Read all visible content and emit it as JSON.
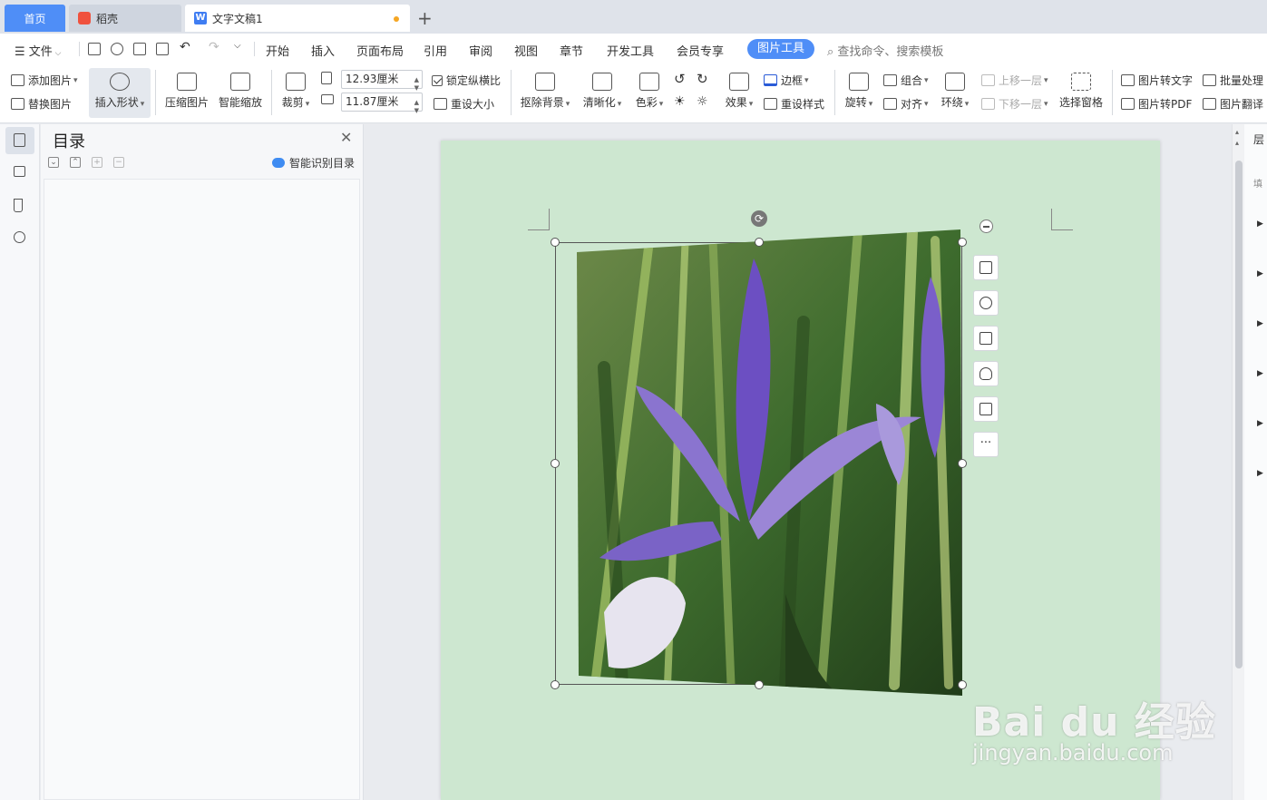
{
  "tabs": {
    "home": "首页",
    "daoke": "稻壳",
    "doc": "文字文稿1"
  },
  "menu": {
    "file": "文件",
    "items": [
      "开始",
      "插入",
      "页面布局",
      "引用",
      "审阅",
      "视图",
      "章节",
      "开发工具",
      "会员专享"
    ],
    "active": "图片工具",
    "search_placeholder": "查找命令、搜索模板"
  },
  "ribbon": {
    "add_image": "添加图片",
    "replace_image": "替换图片",
    "insert_shape": "插入形状",
    "compress": "压缩图片",
    "smart_zoom": "智能缩放",
    "crop": "裁剪",
    "width_value": "12.93厘米",
    "height_value": "11.87厘米",
    "lock_ratio": "锁定纵横比",
    "reset_size": "重设大小",
    "remove_bg": "抠除背景",
    "sharpen": "清晰化",
    "color": "色彩",
    "effects": "效果",
    "border": "边框",
    "reset_style": "重设样式",
    "rotate": "旋转",
    "group": "组合",
    "align": "对齐",
    "wrap": "环绕",
    "bring_forward": "上移一层",
    "send_backward": "下移一层",
    "selection_pane": "选择窗格",
    "img_to_text": "图片转文字",
    "img_to_pdf": "图片转PDF",
    "batch": "批量处理",
    "translate": "图片翻译"
  },
  "toc": {
    "title": "目录",
    "smart_recognize": "智能识别目录"
  },
  "float_tools": {
    "more": "···"
  },
  "watermark": {
    "brand": "Bai du 经验",
    "url": "jingyan.baidu.com"
  },
  "right_panel": {
    "label_top": "层",
    "label_second": "填"
  },
  "colors": {
    "accent": "#4f8ef7",
    "page_bg": "#cde7d0"
  }
}
